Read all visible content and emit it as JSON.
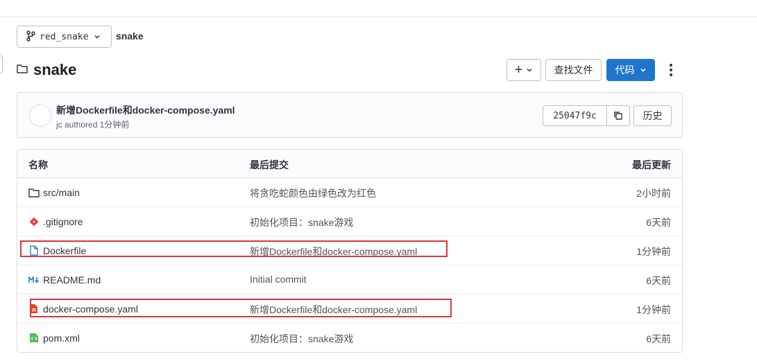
{
  "branch": {
    "name": "red_snake"
  },
  "breadcrumb": {
    "project": "snake"
  },
  "folder": {
    "title": "snake"
  },
  "actions": {
    "plus_label": "+",
    "find_file_label": "查找文件",
    "code_label": "代码",
    "primary_color": "#1f75cb"
  },
  "last_commit": {
    "message": "新增Dockerfile和docker-compose.yaml",
    "meta": "jc authored 1分钟前",
    "sha": "25047f9c",
    "history_label": "历史"
  },
  "table": {
    "headers": {
      "name": "名称",
      "last_commit": "最后提交",
      "last_update": "最后更新"
    },
    "rows": [
      {
        "name": "src/main",
        "icon": "folder-icon",
        "commit": "将贪吃蛇颜色由绿色改为红色",
        "time": "2小时前"
      },
      {
        "name": ".gitignore",
        "icon": "git-icon",
        "commit": "初始化项目：snake游戏",
        "time": "6天前"
      },
      {
        "name": "Dockerfile",
        "icon": "file-icon",
        "commit": "新增Dockerfile和docker-compose.yaml",
        "time": "1分钟前"
      },
      {
        "name": "README.md",
        "icon": "markdown-icon",
        "commit": "Initial commit",
        "time": "6天前"
      },
      {
        "name": "docker-compose.yaml",
        "icon": "yaml-icon",
        "commit": "新增Dockerfile和docker-compose.yaml",
        "time": "1分钟前"
      },
      {
        "name": "pom.xml",
        "icon": "xml-icon",
        "commit": "初始化项目：snake游戏",
        "time": "6天前"
      }
    ]
  },
  "annotation_color": "#e0333a"
}
